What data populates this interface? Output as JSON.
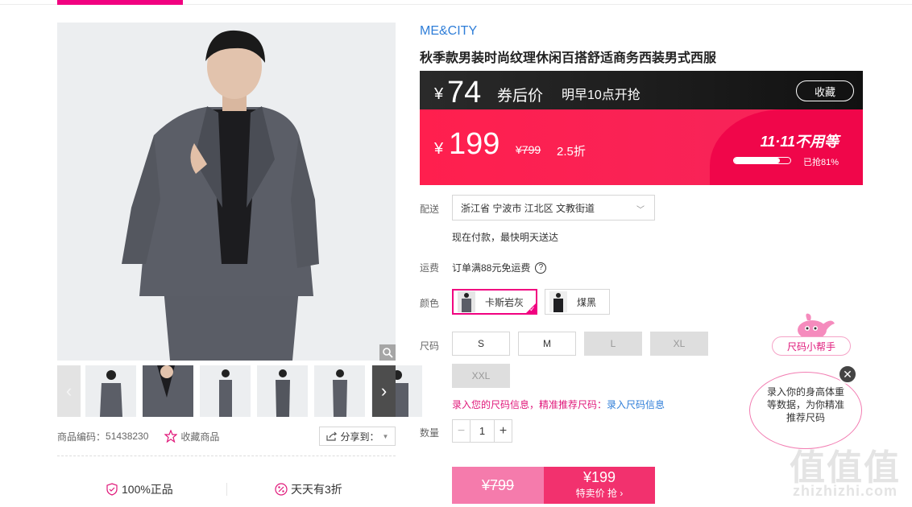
{
  "product": {
    "brand": "ME&CITY",
    "title": "秋季款男装时尚纹理休闲百搭舒适商务西装男式西服",
    "code_label": "商品编码：",
    "code": "51438230",
    "favorite_label": "收藏商品",
    "share_label": "分享到：",
    "promises": [
      "100%正品",
      "天天有3折"
    ]
  },
  "price": {
    "coupon_currency": "¥",
    "coupon_price": "74",
    "coupon_label": "券后价",
    "start_time": "明早10点开抢",
    "collect": "收藏",
    "currency": "¥",
    "sale_price": "199",
    "original_price": "¥799",
    "discount": "2.5折",
    "event": "11·11不用等",
    "grabbed_label": "已抢81%",
    "grabbed_percent": 81
  },
  "delivery": {
    "label": "配送",
    "address": "浙江省 宁波市 江北区 文教街道",
    "note": "现在付款，最快明天送达"
  },
  "shipping": {
    "label": "运费",
    "text": "订单满88元免运费",
    "help": "?"
  },
  "color": {
    "label": "颜色",
    "options": [
      {
        "name": "卡斯岩灰",
        "selected": true
      },
      {
        "name": "煤黑",
        "selected": false
      }
    ]
  },
  "size": {
    "label": "尺码",
    "options": [
      {
        "name": "S",
        "available": true
      },
      {
        "name": "M",
        "available": true
      },
      {
        "name": "L",
        "available": false
      },
      {
        "name": "XL",
        "available": false
      },
      {
        "name": "XXL",
        "available": false
      }
    ],
    "tip_prefix": "录入您的尺码信息，精准推荐尺码：",
    "tip_link": "录入尺码信息"
  },
  "quantity": {
    "label": "数量",
    "value": "1",
    "minus": "−",
    "plus": "+"
  },
  "buy": {
    "original": "¥799",
    "price": "¥199",
    "action": "特卖价 抢 ›"
  },
  "size_helper": {
    "button": "尺码小帮手",
    "bubble": "录入你的身高体重等数据，为你精准推荐尺码",
    "close": "✕"
  },
  "watermark": {
    "mark": "值值值",
    "domain": "zhizhizhi.com"
  },
  "colors": {
    "accent": "#f10180",
    "price_red": "#ff1f4e",
    "link_blue": "#2f7ed8"
  }
}
